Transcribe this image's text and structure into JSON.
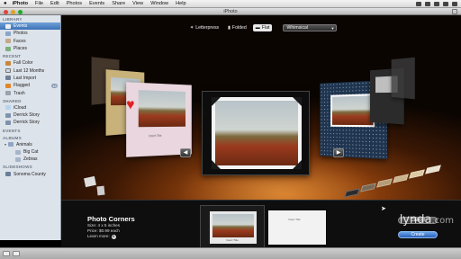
{
  "menubar": {
    "apple": "",
    "app": "iPhoto",
    "items": [
      "File",
      "Edit",
      "Photos",
      "Events",
      "Share",
      "View",
      "Window",
      "Help"
    ]
  },
  "window": {
    "title": "iPhoto"
  },
  "sidebar": {
    "sections": [
      {
        "title": "LIBRARY",
        "items": [
          {
            "label": "Events",
            "icon": "events-icon",
            "selected": true
          },
          {
            "label": "Photos",
            "icon": "photos-icon"
          },
          {
            "label": "Faces",
            "icon": "faces-icon"
          },
          {
            "label": "Places",
            "icon": "places-icon"
          }
        ]
      },
      {
        "title": "RECENT",
        "items": [
          {
            "label": "Fall Color",
            "icon": "event-icon"
          },
          {
            "label": "Last 12 Months",
            "icon": "calendar-icon"
          },
          {
            "label": "Last Import",
            "icon": "import-icon"
          },
          {
            "label": "Flagged",
            "icon": "flag-icon",
            "badge": "16"
          },
          {
            "label": "Trash",
            "icon": "trash-icon"
          }
        ]
      },
      {
        "title": "SHARED",
        "items": [
          {
            "label": "iCloud",
            "icon": "icloud-icon"
          },
          {
            "label": "Derrick Story",
            "icon": "photostream-icon"
          },
          {
            "label": "Derrick Story",
            "icon": "photostream-icon"
          }
        ]
      },
      {
        "title": "EVENTS",
        "items": []
      },
      {
        "title": "ALBUMS",
        "items": [
          {
            "label": "Animals",
            "icon": "folder-icon",
            "level": 1,
            "disclosure": "▾"
          },
          {
            "label": "Big Cat",
            "icon": "album-icon",
            "level": 2
          },
          {
            "label": "Zebras",
            "icon": "album-icon",
            "level": 2
          }
        ]
      },
      {
        "title": "SLIDESHOWS",
        "items": [
          {
            "label": "Sonoma County",
            "icon": "slideshow-icon"
          }
        ]
      }
    ]
  },
  "toolbar": {
    "options": [
      {
        "label": "Letterpress",
        "icon": "star-icon",
        "selected": false
      },
      {
        "label": "Folded",
        "icon": "folded-icon",
        "selected": false
      },
      {
        "label": "Flat",
        "icon": "flat-icon",
        "selected": true
      }
    ],
    "style_select": "Whimsical"
  },
  "stage": {
    "card_caption": "Insert Title",
    "prev_arrow": "◀",
    "next_arrow": "▶"
  },
  "colors": {
    "accent": "#3d72b6",
    "stage_glow": "#c86a1a",
    "create_button": "#2a5fb8",
    "swatches": [
      "#2b2b2b",
      "#7a6a55",
      "#b59c76",
      "#c9b48d",
      "#dccaa5",
      "#e9e1cf"
    ]
  },
  "theme": {
    "name": "Photo Corners",
    "size": "Size: 4 x 5 inches",
    "price": "Price: $0.99 each",
    "learn_more": "Learn more:"
  },
  "thumbs": [
    {
      "caption": "Insert Title",
      "selected": true
    },
    {
      "caption": "Insert Title",
      "selected": false
    }
  ],
  "buttons": {
    "cancel": "Cancel",
    "create": "Create"
  },
  "watermark": {
    "brand": "lynda",
    "suffix": ".com"
  }
}
